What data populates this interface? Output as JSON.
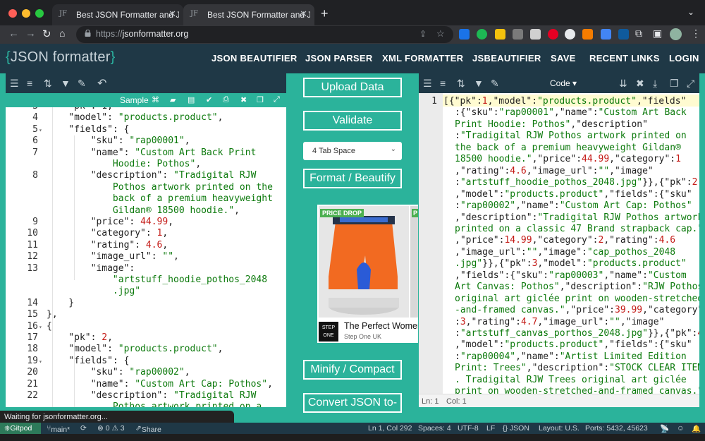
{
  "browser": {
    "tabs": [
      {
        "favicon": "JF",
        "title": "Best JSON Formatter and JSON"
      },
      {
        "favicon": "JF",
        "title": "Best JSON Formatter and JSON"
      }
    ],
    "new_tab": "+",
    "url_prefix": "https://",
    "url_host": "jsonformatter.org"
  },
  "header": {
    "logo": {
      "open": "{",
      "text": "JSON formatter",
      "close": "}"
    },
    "nav": [
      "JSON BEAUTIFIER",
      "JSON PARSER",
      "XML FORMATTER",
      "JSBEAUTIFIER",
      "SAVE",
      "RECENT LINKS",
      "LOGIN"
    ]
  },
  "left_editor": {
    "sample_label": "Sample",
    "lines": [
      {
        "n": "3",
        "fold": false
      },
      {
        "n": "4",
        "fold": false
      },
      {
        "n": "5",
        "fold": true
      },
      {
        "n": "6",
        "fold": false
      },
      {
        "n": "7",
        "fold": false
      },
      {
        "n": "",
        "fold": false
      },
      {
        "n": "8",
        "fold": false
      },
      {
        "n": "",
        "fold": false
      },
      {
        "n": "",
        "fold": false
      },
      {
        "n": "",
        "fold": false
      },
      {
        "n": "9",
        "fold": false
      },
      {
        "n": "10",
        "fold": false
      },
      {
        "n": "11",
        "fold": false
      },
      {
        "n": "12",
        "fold": false
      },
      {
        "n": "13",
        "fold": false
      },
      {
        "n": "",
        "fold": false
      },
      {
        "n": "",
        "fold": false
      },
      {
        "n": "14",
        "fold": false
      },
      {
        "n": "15",
        "fold": false
      },
      {
        "n": "16",
        "fold": true
      },
      {
        "n": "17",
        "fold": false
      },
      {
        "n": "18",
        "fold": false
      },
      {
        "n": "19",
        "fold": true
      },
      {
        "n": "20",
        "fold": false
      },
      {
        "n": "21",
        "fold": false
      },
      {
        "n": "22",
        "fold": false
      },
      {
        "n": "",
        "fold": false
      }
    ],
    "code": [
      [
        {
          "t": "p",
          "v": "    \"pk\": 1,"
        }
      ],
      [
        {
          "t": "p",
          "v": "    \"model\": "
        },
        {
          "t": "s",
          "v": "\"products.product\""
        },
        {
          "t": "p",
          "v": ","
        }
      ],
      [
        {
          "t": "p",
          "v": "    \"fields\": {"
        }
      ],
      [
        {
          "t": "p",
          "v": "        \"sku\": "
        },
        {
          "t": "s",
          "v": "\"rap00001\""
        },
        {
          "t": "p",
          "v": ","
        }
      ],
      [
        {
          "t": "p",
          "v": "        \"name\": "
        },
        {
          "t": "s",
          "v": "\"Custom Art Back Print"
        }
      ],
      [
        {
          "t": "s",
          "v": "            Hoodie: Pothos\""
        },
        {
          "t": "p",
          "v": ","
        }
      ],
      [
        {
          "t": "p",
          "v": "        \"description\": "
        },
        {
          "t": "s",
          "v": "\"Tradigital RJW"
        }
      ],
      [
        {
          "t": "s",
          "v": "            Pothos artwork printed on the"
        }
      ],
      [
        {
          "t": "s",
          "v": "            back of a premium heavyweight"
        }
      ],
      [
        {
          "t": "s",
          "v": "            Gildan® 18500 hoodie.\""
        },
        {
          "t": "p",
          "v": ","
        }
      ],
      [
        {
          "t": "p",
          "v": "        \"price\": "
        },
        {
          "t": "n",
          "v": "44.99"
        },
        {
          "t": "p",
          "v": ","
        }
      ],
      [
        {
          "t": "p",
          "v": "        \"category\": "
        },
        {
          "t": "n",
          "v": "1"
        },
        {
          "t": "p",
          "v": ","
        }
      ],
      [
        {
          "t": "p",
          "v": "        \"rating\": "
        },
        {
          "t": "n",
          "v": "4.6"
        },
        {
          "t": "p",
          "v": ","
        }
      ],
      [
        {
          "t": "p",
          "v": "        \"image_url\": "
        },
        {
          "t": "s",
          "v": "\"\""
        },
        {
          "t": "p",
          "v": ","
        }
      ],
      [
        {
          "t": "p",
          "v": "        \"image\":"
        }
      ],
      [
        {
          "t": "s",
          "v": "            \"artstuff_hoodie_pothos_2048"
        }
      ],
      [
        {
          "t": "s",
          "v": "            .jpg\""
        }
      ],
      [
        {
          "t": "p",
          "v": "    }"
        }
      ],
      [
        {
          "t": "p",
          "v": "},"
        }
      ],
      [
        {
          "t": "p",
          "v": "{"
        }
      ],
      [
        {
          "t": "p",
          "v": "    \"pk\": "
        },
        {
          "t": "n",
          "v": "2"
        },
        {
          "t": "p",
          "v": ","
        }
      ],
      [
        {
          "t": "p",
          "v": "    \"model\": "
        },
        {
          "t": "s",
          "v": "\"products.product\""
        },
        {
          "t": "p",
          "v": ","
        }
      ],
      [
        {
          "t": "p",
          "v": "    \"fields\": {"
        }
      ],
      [
        {
          "t": "p",
          "v": "        \"sku\": "
        },
        {
          "t": "s",
          "v": "\"rap00002\""
        },
        {
          "t": "p",
          "v": ","
        }
      ],
      [
        {
          "t": "p",
          "v": "        \"name\": "
        },
        {
          "t": "s",
          "v": "\"Custom Art Cap: Pothos\""
        },
        {
          "t": "p",
          "v": ","
        }
      ],
      [
        {
          "t": "p",
          "v": "        \"description\": "
        },
        {
          "t": "s",
          "v": "\"Tradigital RJW"
        }
      ],
      [
        {
          "t": "s",
          "v": "            Pothos artwork printed on a"
        }
      ]
    ]
  },
  "middle": {
    "upload": "Upload Data",
    "validate": "Validate",
    "tab_space": "4 Tab Space",
    "format": "Format / Beautify",
    "minify": "Minify / Compact",
    "convert": "Convert JSON to-"
  },
  "ad": {
    "badge": "PRICE DROP",
    "badge_partial": "P",
    "brand_logo": "STEP ONE",
    "title": "The Perfect Women",
    "subtitle": "Step One UK"
  },
  "right_editor": {
    "mode": "Code",
    "line_number": "1",
    "lines": [
      [
        {
          "t": "p",
          "v": "[{\"pk\":"
        },
        {
          "t": "n",
          "v": "1"
        },
        {
          "t": "p",
          "v": ",\"model\":"
        },
        {
          "t": "s",
          "v": "\"products.product\""
        },
        {
          "t": "p",
          "v": ",\"fields\""
        }
      ],
      [
        {
          "t": "p",
          "v": ":{\"sku\":"
        },
        {
          "t": "s",
          "v": "\"rap00001\""
        },
        {
          "t": "p",
          "v": ",\"name\":"
        },
        {
          "t": "s",
          "v": "\"Custom Art Back"
        }
      ],
      [
        {
          "t": "s",
          "v": "Print Hoodie: Pothos\""
        },
        {
          "t": "p",
          "v": ",\"description\""
        }
      ],
      [
        {
          "t": "p",
          "v": ":"
        },
        {
          "t": "s",
          "v": "\"Tradigital RJW Pothos artwork printed on"
        }
      ],
      [
        {
          "t": "s",
          "v": "the back of a premium heavyweight Gildan®"
        }
      ],
      [
        {
          "t": "s",
          "v": "18500 hoodie.\""
        },
        {
          "t": "p",
          "v": ",\"price\":"
        },
        {
          "t": "n",
          "v": "44.99"
        },
        {
          "t": "p",
          "v": ",\"category\":"
        },
        {
          "t": "n",
          "v": "1"
        }
      ],
      [
        {
          "t": "p",
          "v": ",\"rating\":"
        },
        {
          "t": "n",
          "v": "4.6"
        },
        {
          "t": "p",
          "v": ",\"image_url\":"
        },
        {
          "t": "s",
          "v": "\"\""
        },
        {
          "t": "p",
          "v": ",\"image\""
        }
      ],
      [
        {
          "t": "p",
          "v": ":"
        },
        {
          "t": "s",
          "v": "\"artstuff_hoodie_pothos_2048.jpg\""
        },
        {
          "t": "p",
          "v": "}},{\"pk\":"
        },
        {
          "t": "n",
          "v": "2"
        }
      ],
      [
        {
          "t": "p",
          "v": ",\"model\":"
        },
        {
          "t": "s",
          "v": "\"products.product\""
        },
        {
          "t": "p",
          "v": ",\"fields\":{\"sku\""
        }
      ],
      [
        {
          "t": "p",
          "v": ":"
        },
        {
          "t": "s",
          "v": "\"rap00002\""
        },
        {
          "t": "p",
          "v": ",\"name\":"
        },
        {
          "t": "s",
          "v": "\"Custom Art Cap: Pothos\""
        }
      ],
      [
        {
          "t": "p",
          "v": ",\"description\":"
        },
        {
          "t": "s",
          "v": "\"Tradigital RJW Pothos artwork"
        }
      ],
      [
        {
          "t": "s",
          "v": "printed on a classic 47 Brand strapback cap.\""
        }
      ],
      [
        {
          "t": "p",
          "v": ",\"price\":"
        },
        {
          "t": "n",
          "v": "14.99"
        },
        {
          "t": "p",
          "v": ",\"category\":"
        },
        {
          "t": "n",
          "v": "2"
        },
        {
          "t": "p",
          "v": ",\"rating\":"
        },
        {
          "t": "n",
          "v": "4.6"
        }
      ],
      [
        {
          "t": "p",
          "v": ",\"image_url\":"
        },
        {
          "t": "s",
          "v": "\"\""
        },
        {
          "t": "p",
          "v": ",\"image\":"
        },
        {
          "t": "s",
          "v": "\"cap_pothos_2048"
        }
      ],
      [
        {
          "t": "s",
          "v": ".jpg\""
        },
        {
          "t": "p",
          "v": "}},{\"pk\":"
        },
        {
          "t": "n",
          "v": "3"
        },
        {
          "t": "p",
          "v": ",\"model\":"
        },
        {
          "t": "s",
          "v": "\"products.product\""
        }
      ],
      [
        {
          "t": "p",
          "v": ",\"fields\":{\"sku\":"
        },
        {
          "t": "s",
          "v": "\"rap00003\""
        },
        {
          "t": "p",
          "v": ",\"name\":"
        },
        {
          "t": "s",
          "v": "\"Custom"
        }
      ],
      [
        {
          "t": "s",
          "v": "Art Canvas: Pothos\""
        },
        {
          "t": "p",
          "v": ",\"description\":"
        },
        {
          "t": "s",
          "v": "\"RJW Pothos"
        }
      ],
      [
        {
          "t": "s",
          "v": "original art giclée print on wooden-stretched"
        }
      ],
      [
        {
          "t": "s",
          "v": "-and-framed canvas.\""
        },
        {
          "t": "p",
          "v": ",\"price\":"
        },
        {
          "t": "n",
          "v": "39.99"
        },
        {
          "t": "p",
          "v": ",\"category\""
        }
      ],
      [
        {
          "t": "p",
          "v": ":"
        },
        {
          "t": "n",
          "v": "3"
        },
        {
          "t": "p",
          "v": ",\"rating\":"
        },
        {
          "t": "n",
          "v": "4.7"
        },
        {
          "t": "p",
          "v": ",\"image_url\":"
        },
        {
          "t": "s",
          "v": "\"\""
        },
        {
          "t": "p",
          "v": ",\"image\""
        }
      ],
      [
        {
          "t": "p",
          "v": ":"
        },
        {
          "t": "s",
          "v": "\"artstuff_canvas_porthos_2048.jpg\""
        },
        {
          "t": "p",
          "v": "}},{\"pk\":"
        },
        {
          "t": "n",
          "v": "4"
        }
      ],
      [
        {
          "t": "p",
          "v": ",\"model\":"
        },
        {
          "t": "s",
          "v": "\"products.product\""
        },
        {
          "t": "p",
          "v": ",\"fields\":{\"sku\""
        }
      ],
      [
        {
          "t": "p",
          "v": ":"
        },
        {
          "t": "s",
          "v": "\"rap00004\""
        },
        {
          "t": "p",
          "v": ",\"name\":"
        },
        {
          "t": "s",
          "v": "\"Artist Limited Edition"
        }
      ],
      [
        {
          "t": "s",
          "v": "Print: Trees\""
        },
        {
          "t": "p",
          "v": ",\"description\":"
        },
        {
          "t": "s",
          "v": "\"STOCK CLEAR ITEM"
        }
      ],
      [
        {
          "t": "s",
          "v": ". Tradigital RJW Trees original art giclée"
        }
      ],
      [
        {
          "t": "s",
          "v": "print on wooden-stretched-and-framed canvas.\""
        }
      ]
    ],
    "status_ln": "Ln: 1",
    "status_col": "Col: 1"
  },
  "loading_text": "Waiting for jsonformatter.org...",
  "statusbar": {
    "gitpod": "Gitpod",
    "branch": "main*",
    "problems": "⊗ 0 ⚠ 3",
    "share": "Share",
    "position": "Ln 1, Col 292",
    "spaces": "Spaces: 4",
    "encoding": "UTF-8",
    "eol": "LF",
    "language": "{} JSON",
    "layout": "Layout: U.S.",
    "ports": "Ports: 5432, 45623"
  }
}
